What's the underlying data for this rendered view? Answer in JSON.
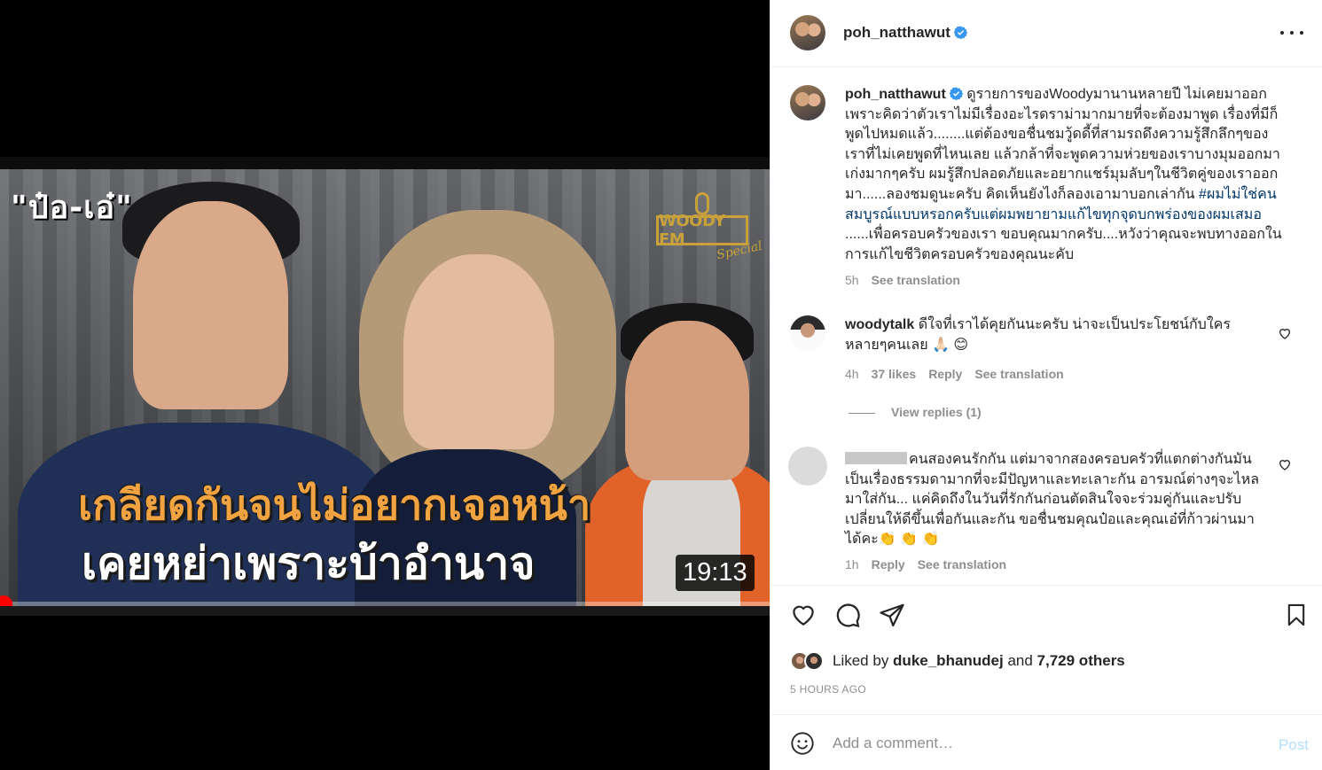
{
  "media": {
    "overlay_name": "\"ป๋อ-เอ๋\"",
    "logo_text": "WOODY FM",
    "logo_sub": "Special",
    "headline_line1": "เกลียดกันจนไม่อยากเจอหน้า",
    "headline_line2": "เคยหย่าเพราะบ้าอำนาจ",
    "duration": "19:13",
    "progress": 0.006
  },
  "header": {
    "username": "poh_natthawut",
    "verified": true
  },
  "caption": {
    "username": "poh_natthawut",
    "text_main": "ดูรายการของWoodyมานานหลายปี ไม่เคยมาออกเพราะคิดว่าตัวเราไม่มีเรื่องอะไรดราม่ามากมายที่จะต้องมาพูด เรื่องที่มีก็พูดไปหมดแล้ว........แต่ต้องขอชื่นชมวู้ดดี้ที่สามรถดึงความรู้สึกลึกๆของเราที่ไม่เคยพูดที่ไหนเลย แล้วกล้าที่จะพูดความห่วยของเราบางมุมออกมา เก่งมากๆครับ ผมรู้สึกปลอดภัยและอยากแชร์มุมลับๆในชีวิตคู่ของเราออกมา......ลองชมดูนะครับ คิดเห็นยังไงก็ลองเอามาบอกเล่ากัน ",
    "hashtag": "#ผมไม่ใช่คนสมบูรณ์แบบหรอกครับแต่ผมพยายามแก้ไขทุกจุดบกพร่องของผมเสมอ",
    "text_end": " ......เพื่อครอบครัวของเรา ขอบคุณมากครับ....หวังว่าคุณจะพบทางออกในการแก้ไขชีวิตครอบครัวของคุณนะคับ",
    "time": "5h",
    "see_translation": "See translation"
  },
  "comments": [
    {
      "username": "woodytalk",
      "text": "ดีใจที่เราได้คุยกันนะครับ น่าจะเป็นประโยชน์กับใครหลายๆคนเลย 🙏🏻 😊",
      "time": "4h",
      "likes": "37 likes",
      "reply": "Reply",
      "see_translation": "See translation",
      "view_replies": "View replies (1)"
    },
    {
      "username": "",
      "text": "คนสองคนรักกัน แต่มาจากสองครอบครัวที่แตกต่างกันมันเป็นเรื่องธรรมดามากที่จะมีปัญหาและทะเลาะกัน อารมณ์ต่างๆจะไหลมาใส่กัน... แค่คิดถึงในวันที่รักกันก่อนตัดสินใจจะร่วมคู่กันและปรับเปลี่ยนให้ดีขึ้นเพื่อกันและกัน ขอชื่นชมคุณป๋อและคุณเอ๋ที่ก้าวผ่านมาได้คะ👏 👏 👏",
      "time": "1h",
      "reply": "Reply",
      "see_translation": "See translation"
    }
  ],
  "actions": {
    "liked_by_prefix": "Liked by ",
    "liked_by_user": "duke_bhanudej",
    "liked_by_and": " and ",
    "liked_by_others": "7,729 others",
    "timestamp": "5 HOURS AGO"
  },
  "composer": {
    "placeholder": "Add a comment…",
    "post_label": "Post"
  },
  "colors": {
    "link_blue": "#00376b",
    "verified_blue": "#3897f0",
    "muted": "#8e8e8e",
    "post_disabled": "#b2dffc",
    "progress_red": "#ff0000"
  }
}
